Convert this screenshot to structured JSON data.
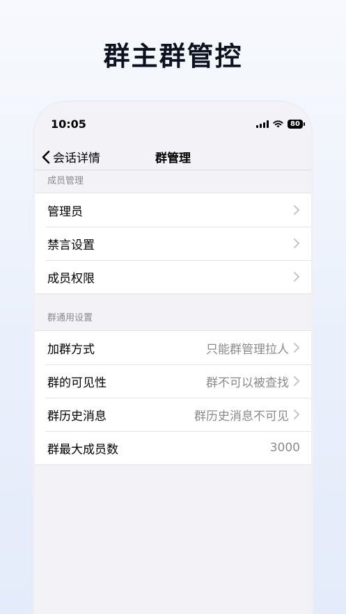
{
  "promo": {
    "title": "群主群管控"
  },
  "status_bar": {
    "time": "10:05",
    "battery": "80"
  },
  "nav": {
    "back_label": "会话详情",
    "title": "群管理"
  },
  "sections": [
    {
      "header": "成员管理",
      "rows": [
        {
          "label": "管理员",
          "value": ""
        },
        {
          "label": "禁言设置",
          "value": ""
        },
        {
          "label": "成员权限",
          "value": ""
        }
      ]
    },
    {
      "header": "群通用设置",
      "rows": [
        {
          "label": "加群方式",
          "value": "只能群管理拉人"
        },
        {
          "label": "群的可见性",
          "value": "群不可以被查找"
        },
        {
          "label": "群历史消息",
          "value": "群历史消息不可见"
        },
        {
          "label": "群最大成员数",
          "value": "3000"
        }
      ]
    }
  ]
}
